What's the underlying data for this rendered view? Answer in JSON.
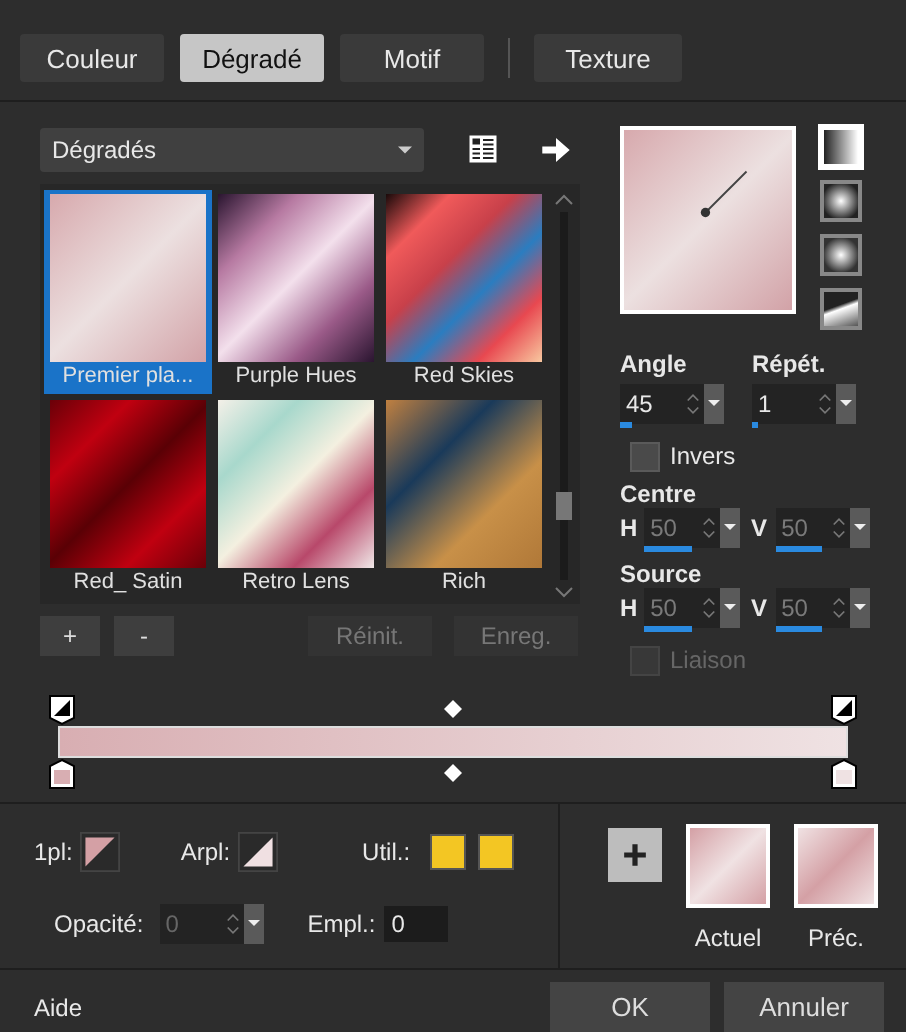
{
  "tabs": [
    {
      "label": "Couleur",
      "selected": false
    },
    {
      "label": "Dégradé",
      "selected": true
    },
    {
      "label": "Motif",
      "selected": false
    },
    {
      "label": "Texture",
      "selected": false
    }
  ],
  "gallery": {
    "category": "Dégradés",
    "items": [
      {
        "label": "Premier pla...",
        "selected": true
      },
      {
        "label": "Purple Hues",
        "selected": false
      },
      {
        "label": "Red Skies",
        "selected": false
      },
      {
        "label": "Red_ Satin",
        "selected": false
      },
      {
        "label": "Retro Lens",
        "selected": false
      },
      {
        "label": "Rich",
        "selected": false
      }
    ],
    "buttons": [
      {
        "label": "+",
        "disabled": false
      },
      {
        "label": "-",
        "disabled": false
      },
      {
        "label": "Réinit.",
        "disabled": true
      },
      {
        "label": "Enreg.",
        "disabled": true
      }
    ]
  },
  "styles": [
    {
      "kind": "linear",
      "selected": true
    },
    {
      "kind": "rectangular",
      "selected": false
    },
    {
      "kind": "radial",
      "selected": false
    },
    {
      "kind": "sunburst",
      "selected": false
    }
  ],
  "angle": {
    "label": "Angle",
    "value": "45",
    "level": 0.12
  },
  "repeat": {
    "label": "Répét.",
    "value": "1",
    "level": 0.05
  },
  "invert": {
    "label": "Invers",
    "checked": false,
    "disabled": false
  },
  "centre": {
    "label": "Centre",
    "disabled": true,
    "h_label": "H",
    "h": {
      "value": "50",
      "level": 0.5
    },
    "v_label": "V",
    "v": {
      "value": "50",
      "level": 0.5
    }
  },
  "source": {
    "label": "Source",
    "disabled": true,
    "h_label": "H",
    "h": {
      "value": "50",
      "level": 0.5
    },
    "v_label": "V",
    "v": {
      "value": "50",
      "level": 0.5
    }
  },
  "link": {
    "label": "Liaison",
    "checked": false,
    "disabled": true
  },
  "foreground": {
    "label": "1pl:"
  },
  "background": {
    "label": "Arpl:"
  },
  "user": {
    "label": "Util.:"
  },
  "opacity": {
    "label": "Opacité:",
    "value": "0",
    "disabled": true
  },
  "location": {
    "label": "Empl.:",
    "value": "0"
  },
  "current": {
    "label": "Actuel"
  },
  "previous": {
    "label": "Préc."
  },
  "footer": {
    "help": "Aide",
    "ok": "OK",
    "cancel": "Annuler"
  }
}
